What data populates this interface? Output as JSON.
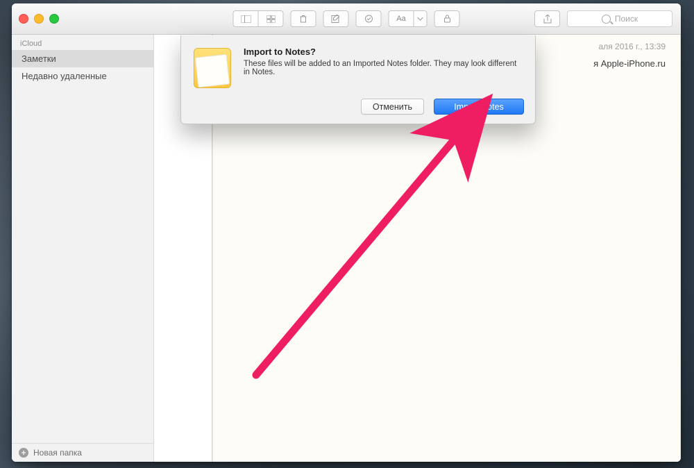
{
  "sidebar": {
    "header": "iCloud",
    "items": [
      {
        "label": "Заметки",
        "selected": true
      },
      {
        "label": "Недавно удаленные",
        "selected": false
      }
    ],
    "newFolder": "Новая папка"
  },
  "note": {
    "dateFragment": "аля 2016 г., 13:39",
    "bodyFragment": "я Apple-iPhone.ru"
  },
  "toolbar": {
    "searchPlaceholder": "Поиск"
  },
  "dialog": {
    "title": "Import to Notes?",
    "message": "These files will be added to an Imported Notes folder. They may look different in Notes.",
    "cancel": "Отменить",
    "confirm": "Import Notes"
  }
}
